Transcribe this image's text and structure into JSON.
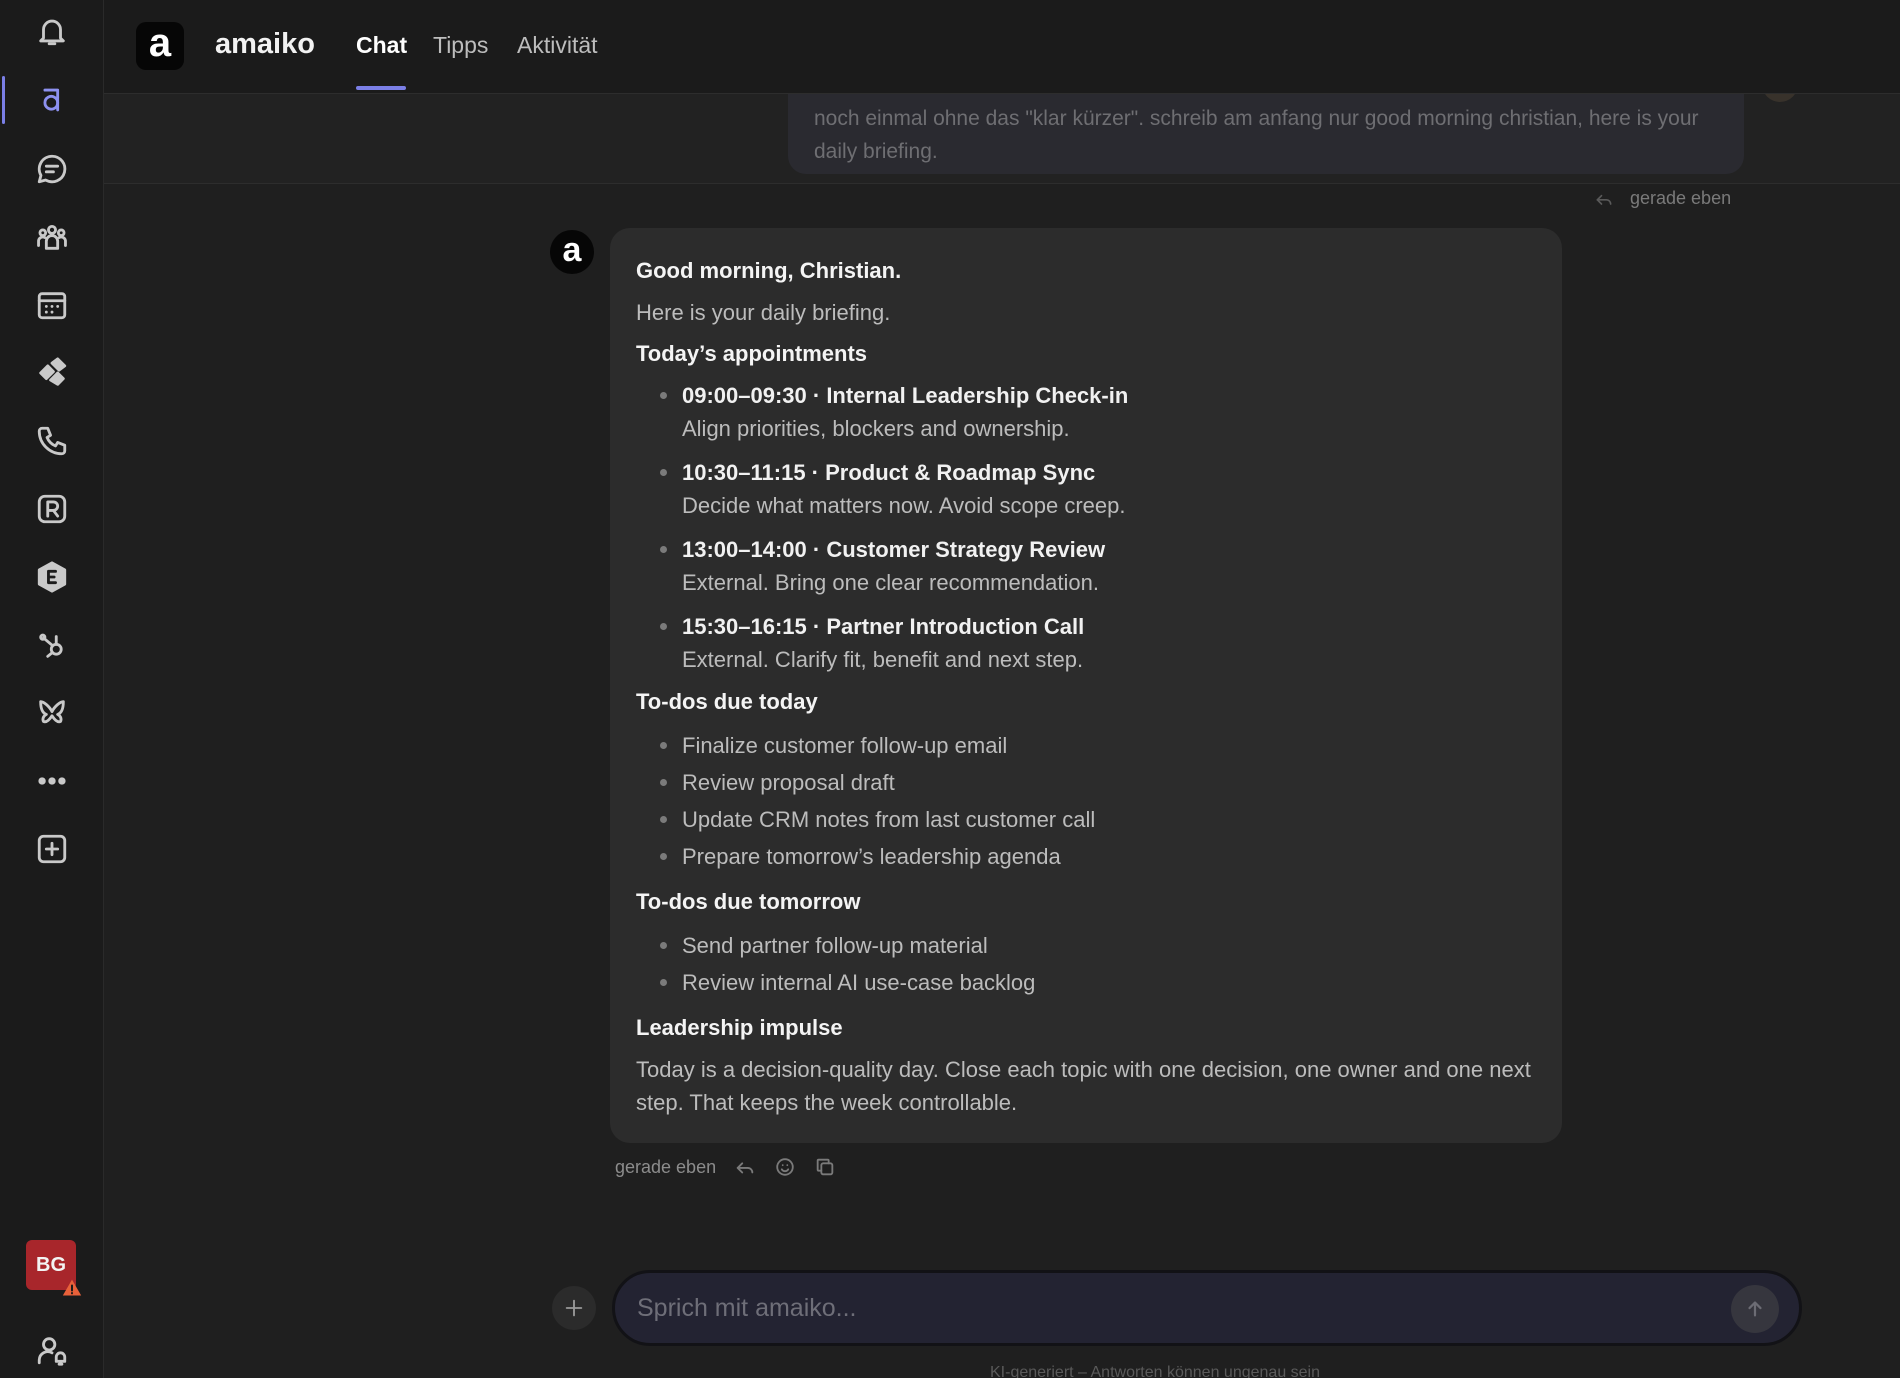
{
  "header": {
    "logo_letter": "a",
    "app_name": "amaiko",
    "tabs": [
      {
        "label": "Chat",
        "active": true
      },
      {
        "label": "Tipps",
        "active": false
      },
      {
        "label": "Aktivität",
        "active": false
      }
    ]
  },
  "rail": {
    "items": [
      "bell-icon",
      "amaiko-icon",
      "chat-icon",
      "teams-icon",
      "calendar-icon",
      "planner-icon",
      "phone-icon",
      "r-app-icon",
      "e-app-icon",
      "hubspot-icon",
      "butterfly-icon",
      "more-icon",
      "add-app-icon"
    ],
    "user_initials": "BG",
    "accent_color": "#7b7fe6"
  },
  "previous_message": {
    "text": "noch einmal ohne das \"klar kürzer\". schreib am anfang nur good morning christian, here is your daily briefing.",
    "time": "gerade eben"
  },
  "message": {
    "greeting": "Good morning, Christian.",
    "intro": "Here is your daily briefing.",
    "appointments_heading": "Today’s appointments",
    "appointments": [
      {
        "title": "09:00–09:30 · Internal Leadership Check-in",
        "note": "Align priorities, blockers and ownership."
      },
      {
        "title": "10:30–11:15 · Product & Roadmap Sync",
        "note": "Decide what matters now. Avoid scope creep."
      },
      {
        "title": "13:00–14:00 · Customer Strategy Review",
        "note": "External. Bring one clear recommendation."
      },
      {
        "title": "15:30–16:15 · Partner Introduction Call",
        "note": "External. Clarify fit, benefit and next step."
      }
    ],
    "todos_today_heading": "To-dos due today",
    "todos_today": [
      "Finalize customer follow-up email",
      "Review proposal draft",
      "Update CRM notes from last customer call",
      "Prepare tomorrow’s leadership agenda"
    ],
    "todos_tomorrow_heading": "To-dos due tomorrow",
    "todos_tomorrow": [
      "Send partner follow-up material",
      "Review internal AI use-case backlog"
    ],
    "impulse_heading": "Leadership impulse",
    "impulse_text": "Today is a decision-quality day. Close each topic with one decision, one owner and one next step. That keeps the week controllable.",
    "time": "gerade eben"
  },
  "composer": {
    "placeholder": "Sprich mit amaiko...",
    "disclaimer": "KI-generiert – Antworten können ungenau sein"
  }
}
